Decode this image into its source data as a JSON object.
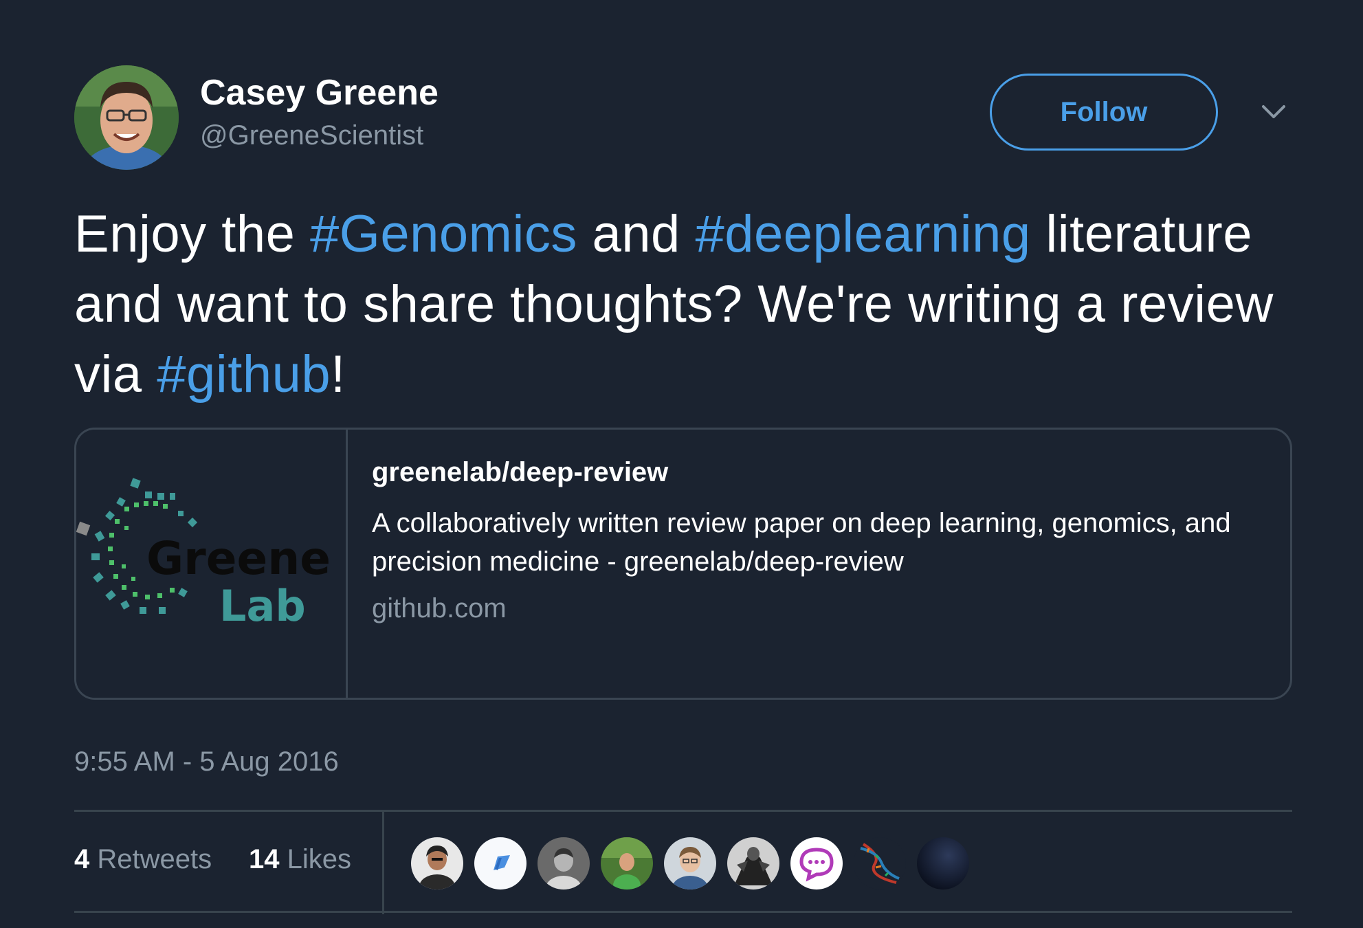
{
  "author": {
    "name": "Casey Greene",
    "handle": "@GreeneScientist",
    "avatar_icon": "profile-photo"
  },
  "follow_label": "Follow",
  "menu_icon": "chevron-down-icon",
  "tweet": {
    "p1": "Enjoy the ",
    "tag1": "#Genomics",
    "p2": " and ",
    "tag2": "#deeplearning",
    "p3": " literature and want to share thoughts? We're writing a review via ",
    "tag3": "#github",
    "p4": "!"
  },
  "card": {
    "title": "greenelab/deep-review",
    "description": "A collaboratively written review paper on deep learning, genomics, and precision medicine - greenelab/deep-review",
    "domain": "github.com",
    "logo": {
      "line1": "Greene",
      "line2": "Lab"
    }
  },
  "timestamp": "9:55 AM - 5 Aug 2016",
  "stats": {
    "retweets_count": "4",
    "retweets_label": "Retweets",
    "likes_count": "14",
    "likes_label": "Likes"
  },
  "colors": {
    "background": "#1b2330",
    "accent": "#4a9fe8",
    "muted": "#8b98a5",
    "border": "#38444d"
  }
}
